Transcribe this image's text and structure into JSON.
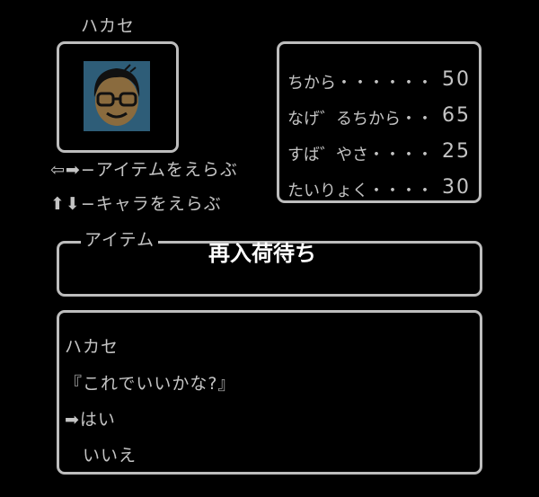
{
  "character": {
    "name": "ハカセ"
  },
  "help": {
    "item_select": "−アイテムをえらぶ",
    "chara_select": "−キャラをえらぶ"
  },
  "stats": [
    {
      "label": "ちから",
      "dots": "・・・・・・",
      "value": "50"
    },
    {
      "label": "なげ゛るちから",
      "dots": "・・",
      "value": "65"
    },
    {
      "label": "すば゛やさ",
      "dots": "・・・・",
      "value": "25"
    },
    {
      "label": "たいりょく",
      "dots": "・・・・",
      "value": "30"
    }
  ],
  "item_box": {
    "title": "アイテム"
  },
  "overlay_text": "再入荷待ち",
  "dialog": {
    "speaker": "ハカセ",
    "message": "『これでいいかな?』",
    "options": [
      "はい",
      "いいえ"
    ]
  },
  "colors": {
    "background": "#000000",
    "frame": "#bdbdbd",
    "text": "#c4c4c4",
    "portrait_bg": "#2e5d78"
  }
}
